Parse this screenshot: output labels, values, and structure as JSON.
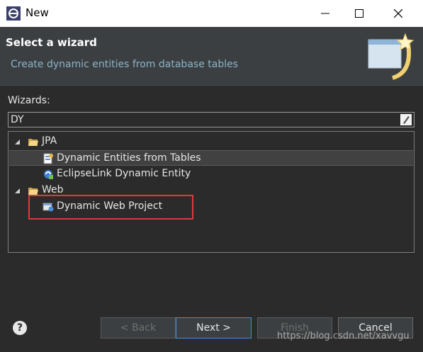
{
  "window": {
    "title": "New"
  },
  "header": {
    "title": "Select a wizard",
    "description": "Create dynamic entities from database tables"
  },
  "wizards": {
    "label": "Wizards:",
    "filter_value": "DY"
  },
  "tree": {
    "items": [
      {
        "label": "JPA",
        "icon": "folder-open-icon",
        "expanded": true
      },
      {
        "label": "Dynamic Entities from Tables",
        "icon": "entity-icon",
        "selected": true
      },
      {
        "label": "EclipseLink Dynamic Entity",
        "icon": "eclipselink-icon"
      },
      {
        "label": "Web",
        "icon": "folder-open-icon",
        "expanded": true
      },
      {
        "label": "Dynamic Web Project",
        "icon": "web-project-icon"
      }
    ]
  },
  "buttons": {
    "help": "?",
    "back": "< Back",
    "next": "Next >",
    "finish": "Finish",
    "cancel": "Cancel"
  },
  "watermark": "https://blog.csdn.net/xavvgu",
  "colors": {
    "highlight": "#e0393d",
    "default_button_border": "#3f8fd8",
    "header_desc": "#8ab4c8"
  }
}
